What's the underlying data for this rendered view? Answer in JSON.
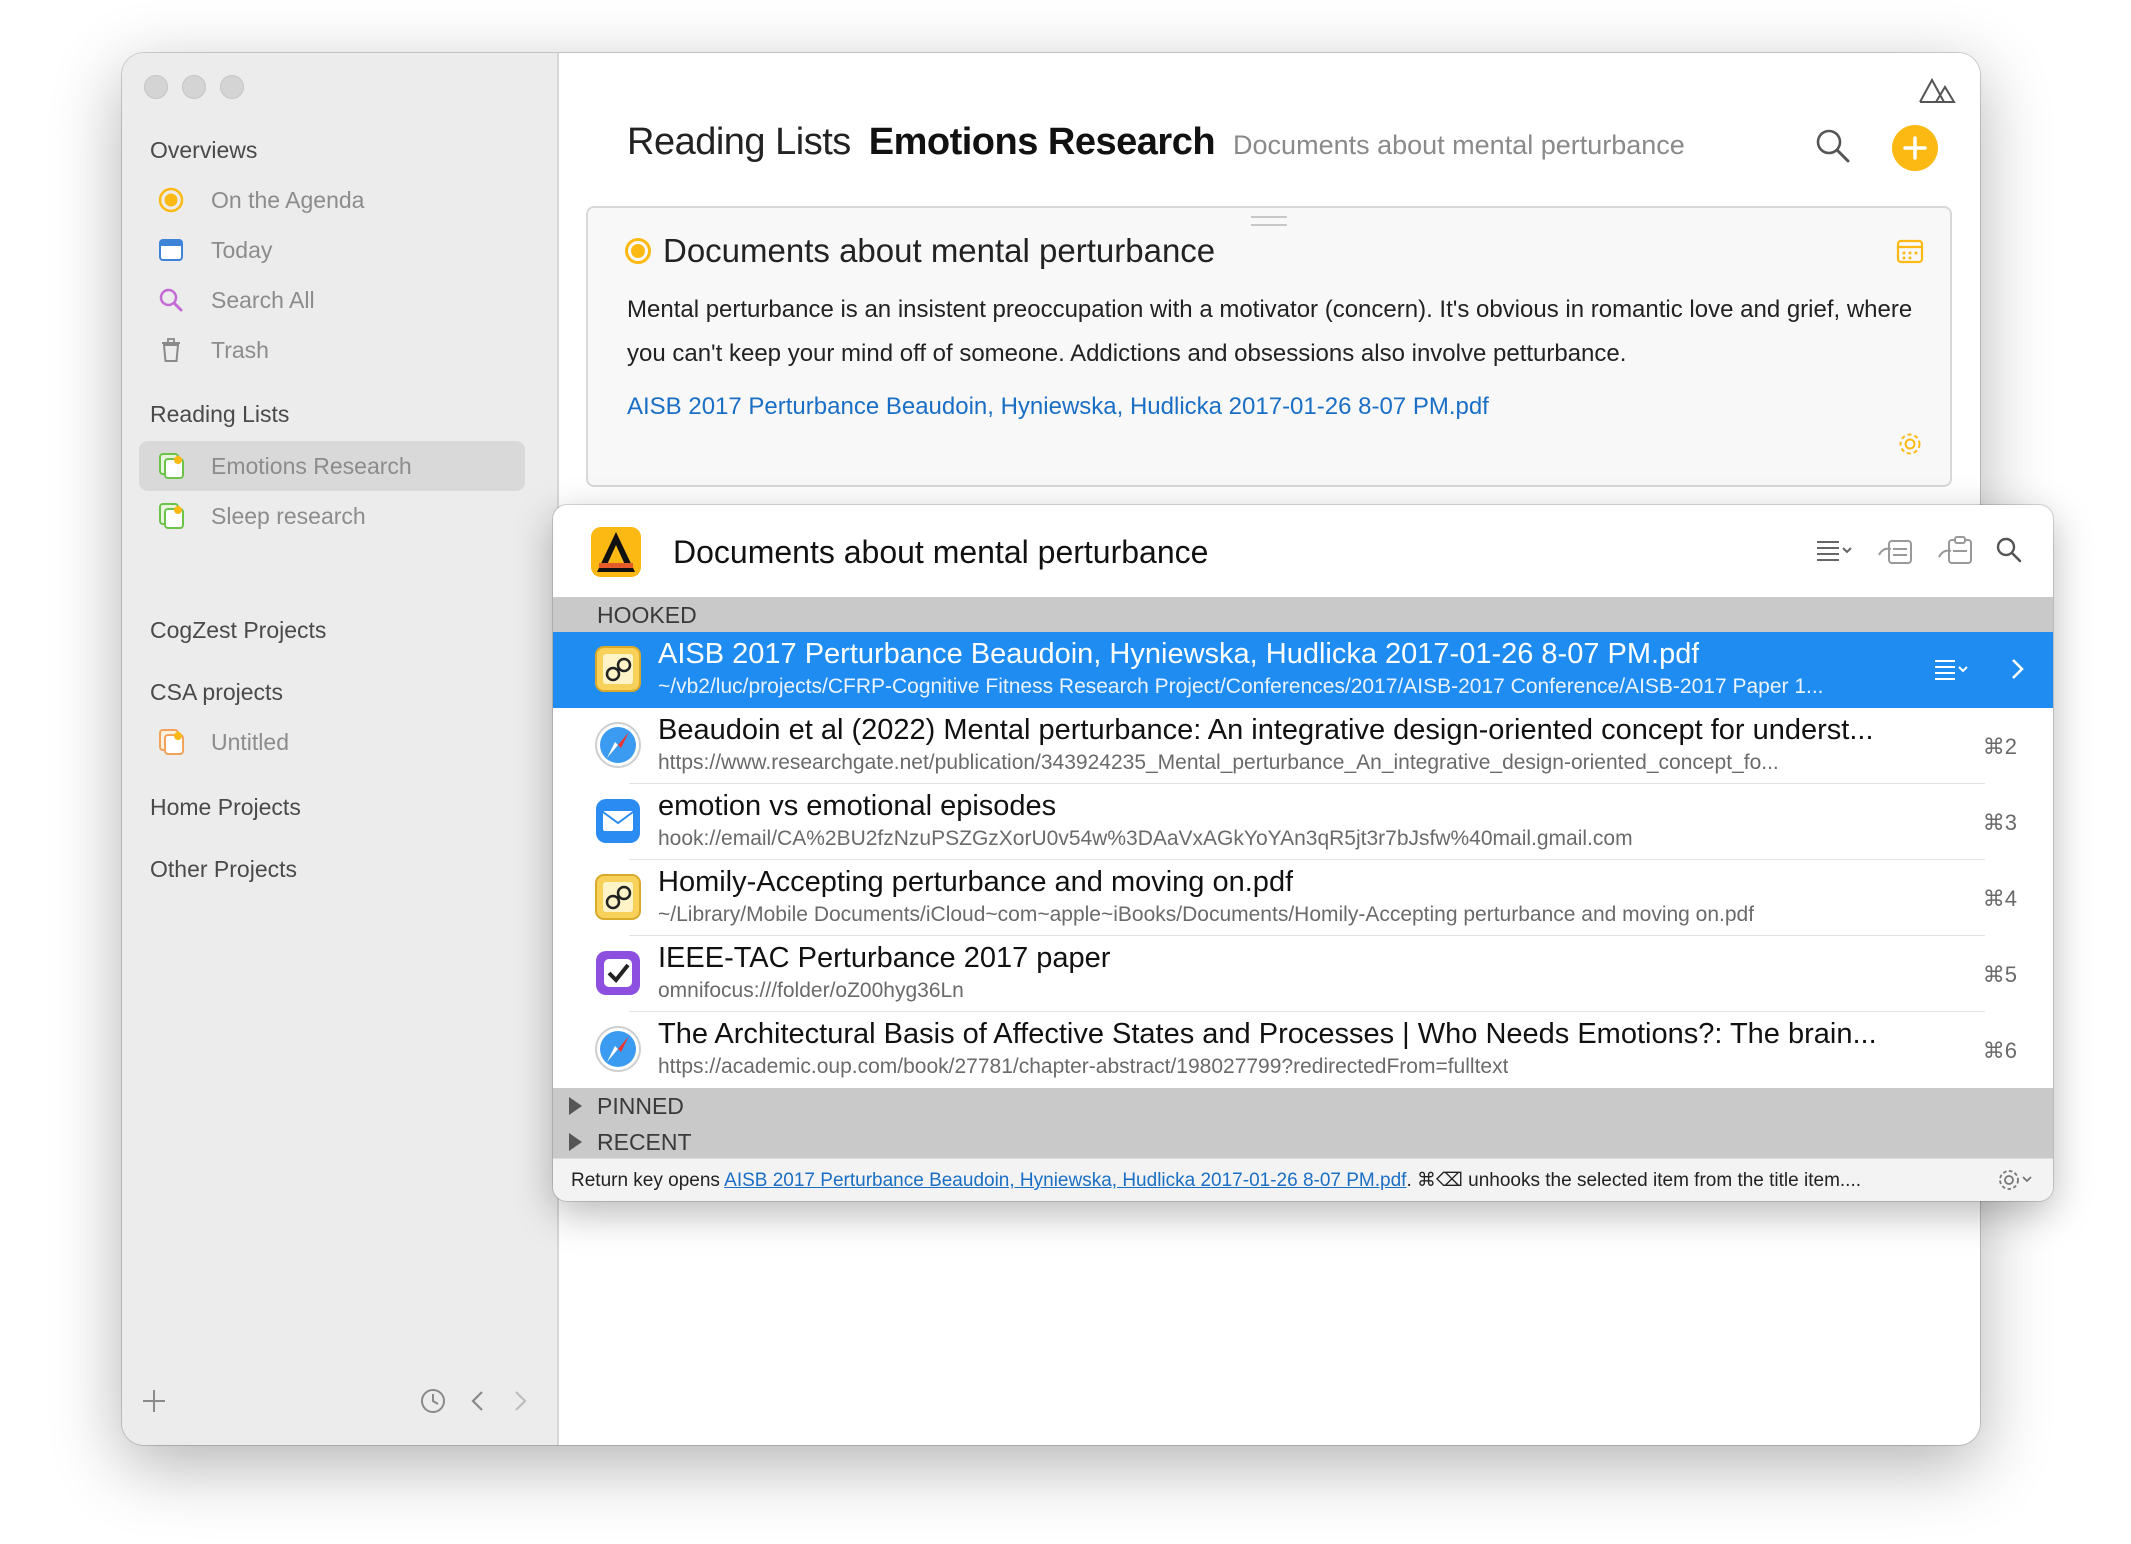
{
  "sidebar": {
    "sections": {
      "overviews": "Overviews",
      "reading_lists": "Reading Lists",
      "cogzest": "CogZest Projects",
      "csa": "CSA projects",
      "home": "Home Projects",
      "other": "Other Projects"
    },
    "items": {
      "agenda": "On the Agenda",
      "today": "Today",
      "search_all": "Search All",
      "trash": "Trash",
      "emotions": "Emotions Research",
      "sleep": "Sleep research",
      "untitled": "Untitled"
    },
    "selected_item": "emotions"
  },
  "header": {
    "breadcrumb": "Reading Lists",
    "title": "Emotions Research",
    "subtitle": "Documents about mental perturbance"
  },
  "card": {
    "title": "Documents about mental perturbance",
    "body": "Mental perturbance is an insistent preoccupation with a motivator (concern). It's obvious in romantic love and grief, where you can't keep your mind off of someone. Addictions and obsessions also involve petturbance.",
    "link": "AISB 2017 Perturbance  Beaudoin, Hyniewska, Hudlicka 2017-01-26 8-07 PM.pdf"
  },
  "popup": {
    "title": "Documents about mental perturbance",
    "section_hooked": "HOOKED",
    "section_pinned": "PINNED",
    "section_recent": "RECENT",
    "items": [
      {
        "title": "AISB 2017 Perturbance  Beaudoin, Hyniewska, Hudlicka 2017-01-26 8-07 PM.pdf",
        "sub": "~/vb2/luc/projects/CFRP-Cognitive Fitness Research Project/Conferences/2017/AISB-2017 Conference/AISB-2017 Paper 1...",
        "key": "",
        "icon": "preview-icon"
      },
      {
        "title": "Beaudoin et al (2022) Mental perturbance: An integrative design-oriented concept for underst...",
        "sub": "https://www.researchgate.net/publication/343924235_Mental_perturbance_An_integrative_design-oriented_concept_fo...",
        "key": "⌘2",
        "icon": "safari-icon"
      },
      {
        "title": "emotion vs emotional episodes",
        "sub": "hook://email/CA%2BU2fzNzuPSZGzXorU0v54w%3DAaVxAGkYoYAn3qR5jt3r7bJsfw%40mail.gmail.com",
        "key": "⌘3",
        "icon": "mail-icon"
      },
      {
        "title": "Homily-Accepting perturbance and moving on.pdf",
        "sub": "~/Library/Mobile Documents/iCloud~com~apple~iBooks/Documents/Homily-Accepting perturbance and moving on.pdf",
        "key": "⌘4",
        "icon": "preview-icon"
      },
      {
        "title": "IEEE-TAC Perturbance 2017 paper",
        "sub": "omnifocus:///folder/oZ00hyg36Ln",
        "key": "⌘5",
        "icon": "omnifocus-icon"
      },
      {
        "title": "The Architectural Basis of Affective States and Processes | Who Needs Emotions?: The brain...",
        "sub": "https://academic.oup.com/book/27781/chapter-abstract/198027799?redirectedFrom=fulltext",
        "key": "⌘6",
        "icon": "safari-icon"
      }
    ],
    "footer": {
      "prefix": "Return key opens ",
      "link": "AISB 2017 Perturbance  Beaudoin, Hyniewska, Hudlicka 2017-01-26 8-07 PM.pdf",
      "suffix": ". ⌘⌫ unhooks the selected item from the title item...."
    }
  },
  "colors": {
    "accent": "#fdb913",
    "selection": "#1e8cf0",
    "link": "#1a6fc5"
  }
}
